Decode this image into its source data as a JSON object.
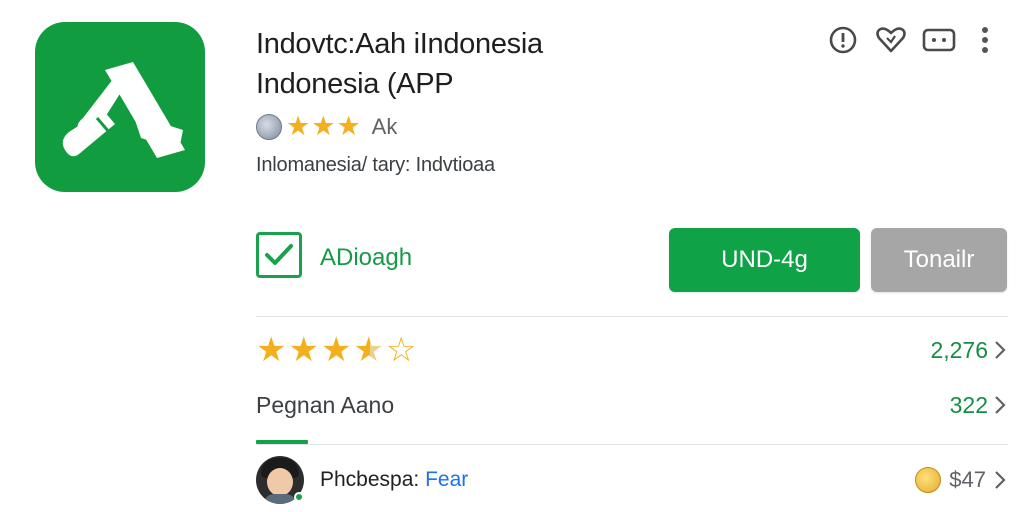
{
  "app": {
    "title_line1": "Indovtc:Aah iIndonesia",
    "title_line2": "Indonesia (APP",
    "rating_text": "Ak",
    "subtitle": "Inlomanesia/ tary: Indvtioaa",
    "icon": "app-logo-icon",
    "brand_color": "#119c3f"
  },
  "toolbar": {
    "icons": [
      "info-icon",
      "heart-icon",
      "message-icon",
      "more-vert-icon"
    ]
  },
  "install": {
    "label": "ADioagh",
    "checked": true
  },
  "buttons": {
    "primary_label": "UND-4g",
    "secondary_label": "Tonailr"
  },
  "reviews": {
    "stars": 3.5,
    "count": "2,276"
  },
  "info_row": {
    "label": "Pegnan Aano",
    "value": "322"
  },
  "user_row": {
    "name": "Phcbespa:",
    "link": "Fear",
    "price": "$47"
  },
  "colors": {
    "accent_green": "#0fa247",
    "star": "#f2b01e",
    "secondary_button": "#a6a6a6"
  }
}
